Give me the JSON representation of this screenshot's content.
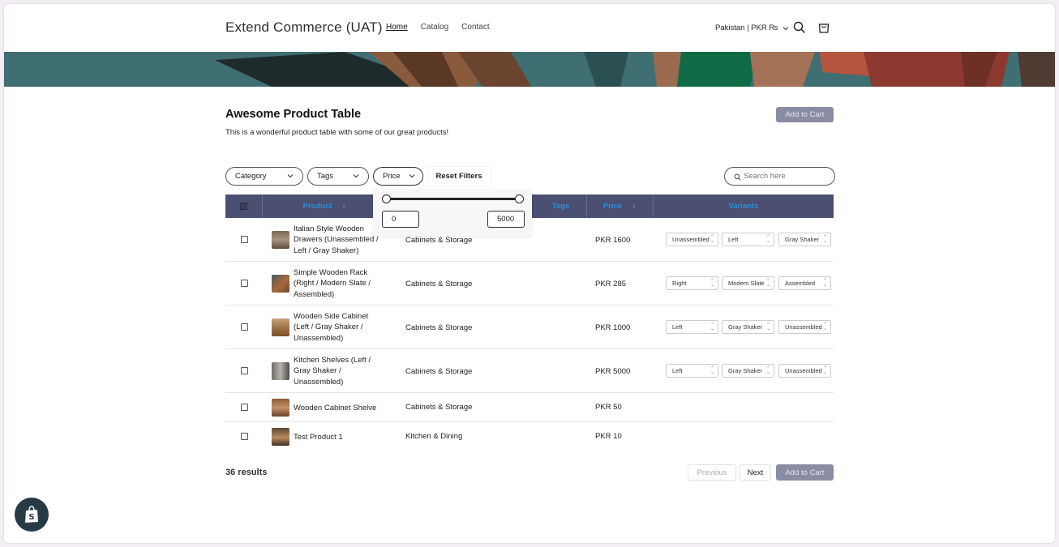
{
  "header": {
    "store_name": "Extend Commerce (UAT)",
    "nav": [
      {
        "label": "Home",
        "active": true
      },
      {
        "label": "Catalog",
        "active": false
      },
      {
        "label": "Contact",
        "active": false
      }
    ],
    "country": "Pakistan | PKR ₨",
    "icons": [
      "chevron-down-icon",
      "search-icon",
      "cart-icon"
    ]
  },
  "main": {
    "title": "Awesome Product Table",
    "subtitle": "This is a wonderful product table with some of our great products!",
    "add_to_cart": "Add to Cart"
  },
  "filters": {
    "category": "Category",
    "tags": "Tags",
    "price": "Price",
    "reset": "Reset Filters",
    "search_placeholder": "Search here",
    "price_min": "0",
    "price_max": "5000"
  },
  "table": {
    "columns": [
      "Product",
      "Tags",
      "Price",
      "Variants"
    ],
    "rows": [
      {
        "name": "Italian Style Wooden Drawers (Unassembled / Left / Gray Shaker)",
        "category": "Cabinets & Storage",
        "price": "PKR 1600",
        "variants": [
          "Unassembled",
          "Left",
          "Gray Shaker"
        ]
      },
      {
        "name": "Simple Wooden Rack (Right / Modern Slate / Assembled)",
        "category": "Cabinets & Storage",
        "price": "PKR 285",
        "variants": [
          "Right",
          "Modern Slate",
          "Assembled"
        ]
      },
      {
        "name": "Wooden Side Cabinet (Left / Gray Shaker / Unassembled)",
        "category": "Cabinets & Storage",
        "price": "PKR 1000",
        "variants": [
          "Left",
          "Gray Shaker",
          "Unassembled"
        ]
      },
      {
        "name": "Kitchen Shelves (Left / Gray Shaker / Unassembled)",
        "category": "Cabinets & Storage",
        "price": "PKR 5000",
        "variants": [
          "Left",
          "Gray Shaker",
          "Unassembled"
        ]
      },
      {
        "name": "Wooden Cabinet Shelve",
        "category": "Cabinets & Storage",
        "price": "PKR 50",
        "variants": []
      },
      {
        "name": "Test Product 1",
        "category": "Kitchen & Dining",
        "price": "PKR 10",
        "variants": []
      }
    ]
  },
  "footer": {
    "results": "36 results",
    "previous": "Previous",
    "next": "Next",
    "add_to_cart": "Add to Cart"
  },
  "colors": {
    "table_header": "#4b4f72",
    "header_text": "#2e8fd6",
    "cart_button": "#8a8ca3",
    "banner": "#3f6e73"
  }
}
